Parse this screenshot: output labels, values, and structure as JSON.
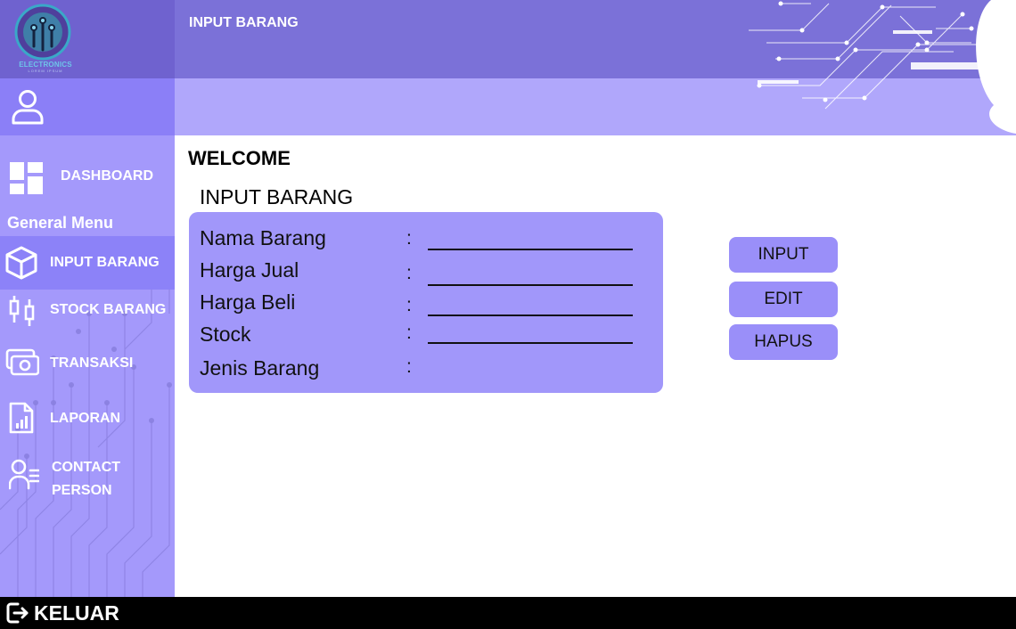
{
  "app": {
    "logo_name": "ELECTRONICS",
    "logo_tagline": "LOREM IPSUM",
    "header_title": "INPUT BARANG"
  },
  "sidebar": {
    "dashboard_label": "DASHBOARD",
    "menu_heading": "General Menu",
    "items": [
      {
        "label": "INPUT BARANG",
        "icon": "cube-icon",
        "active": true
      },
      {
        "label": "STOCK BARANG",
        "icon": "candlestick-icon",
        "active": false
      },
      {
        "label": "TRANSAKSI",
        "icon": "cash-icon",
        "active": false
      },
      {
        "label": "LAPORAN",
        "icon": "report-file-icon",
        "active": false
      },
      {
        "label_line1": "CONTACT",
        "label_line2": "PERSON",
        "icon": "contact-list-icon",
        "active": false
      }
    ]
  },
  "main": {
    "welcome": "WELCOME",
    "form_title": "INPUT BARANG",
    "fields": [
      {
        "label": "Nama Barang",
        "separator": ":",
        "value": ""
      },
      {
        "label": "Harga Jual",
        "separator": ":",
        "value": ""
      },
      {
        "label": "Harga Beli",
        "separator": ":",
        "value": ""
      },
      {
        "label": "Stock",
        "separator": ":",
        "value": ""
      },
      {
        "label": "Jenis Barang",
        "separator": ":",
        "value": ""
      }
    ],
    "buttons": {
      "input": "INPUT",
      "edit": "EDIT",
      "delete": "HAPUS"
    }
  },
  "footer": {
    "logout_label": "KELUAR"
  },
  "colors": {
    "header": "#7b71d8",
    "sub_header": "#b0a7fb",
    "sidebar": "#a499fb",
    "sidebar_active": "#8c82f8",
    "form_card": "#a197fa",
    "button": "#9a8ff9",
    "footer": "#000000"
  }
}
